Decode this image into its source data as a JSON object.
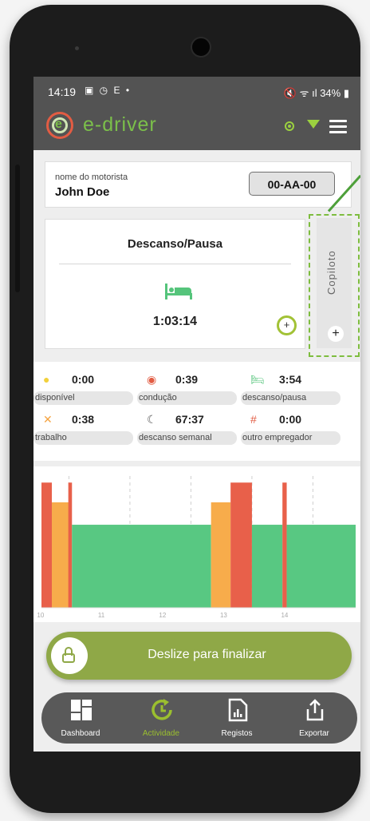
{
  "status_bar": {
    "time": "14:19",
    "left_icons": "▣ ◷ E  •",
    "right_text": "🔇 ᯤ ıl 34% ▮"
  },
  "app": {
    "name": "e-driver"
  },
  "driver": {
    "label": "nome do motorista",
    "name": "John Doe",
    "plate": "00-AA-00"
  },
  "activity": {
    "title": "Descanso/Pausa",
    "elapsed": "1:03:14",
    "add_symbol": "+"
  },
  "copilot": {
    "label": "Copiloto",
    "add_symbol": "+"
  },
  "stats": [
    {
      "icon": "sun-icon",
      "glyph": "●",
      "color": "#f2d13c",
      "value": "0:00",
      "label": "disponível"
    },
    {
      "icon": "steering-wheel-icon",
      "glyph": "◉",
      "color": "#e25c43",
      "value": "0:39",
      "label": "condução"
    },
    {
      "icon": "bed-icon",
      "glyph": "🛏",
      "color": "#55c47b",
      "value": "3:54",
      "label": "descanso/pausa"
    },
    {
      "icon": "tools-icon",
      "glyph": "✕",
      "color": "#f5a442",
      "value": "0:38",
      "label": "trabalho"
    },
    {
      "icon": "moon-icon",
      "glyph": "☾",
      "color": "#555555",
      "value": "67:37",
      "label": "descanso semanal"
    },
    {
      "icon": "hash-icon",
      "glyph": "#",
      "color": "#e25c43",
      "value": "0:00",
      "label": "outro empregador"
    }
  ],
  "chart_data": {
    "type": "bar",
    "x_ticks": [
      "10",
      "11",
      "12",
      "13",
      "14"
    ],
    "segments": [
      {
        "start": 9.55,
        "end": 9.72,
        "type": "condução",
        "color": "#e8604a",
        "level": 0.95
      },
      {
        "start": 9.72,
        "end": 10.0,
        "type": "trabalho",
        "color": "#f7ac4b",
        "level": 0.8
      },
      {
        "start": 9.99,
        "end": 10.05,
        "type": "condução",
        "color": "#e8604a",
        "level": 0.95
      },
      {
        "start": 10.05,
        "end": 12.33,
        "type": "descanso/pausa",
        "color": "#58c882",
        "level": 0.63
      },
      {
        "start": 12.33,
        "end": 12.65,
        "type": "trabalho",
        "color": "#f7ac4b",
        "level": 0.8
      },
      {
        "start": 12.65,
        "end": 13.0,
        "type": "condução",
        "color": "#e8604a",
        "level": 0.95
      },
      {
        "start": 13.0,
        "end": 13.5,
        "type": "descanso/pausa",
        "color": "#58c882",
        "level": 0.63
      },
      {
        "start": 13.5,
        "end": 13.57,
        "type": "condução",
        "color": "#e8604a",
        "level": 0.95
      },
      {
        "start": 13.57,
        "end": 14.7,
        "type": "descanso/pausa",
        "color": "#58c882",
        "level": 0.63
      }
    ],
    "xlim": [
      9.55,
      14.7
    ],
    "ylim": [
      0,
      1
    ]
  },
  "slider": {
    "label": "Deslize para finalizar"
  },
  "nav": [
    {
      "label": "Dashboard",
      "icon": "dashboard-icon",
      "active": false
    },
    {
      "label": "Actividade",
      "icon": "activity-icon",
      "active": true
    },
    {
      "label": "Registos",
      "icon": "report-icon",
      "active": false
    },
    {
      "label": "Exportar",
      "icon": "export-icon",
      "active": false
    }
  ],
  "colors": {
    "accent": "#7bbf4a",
    "slider": "#8fa847",
    "bar_dark": "#535353"
  }
}
